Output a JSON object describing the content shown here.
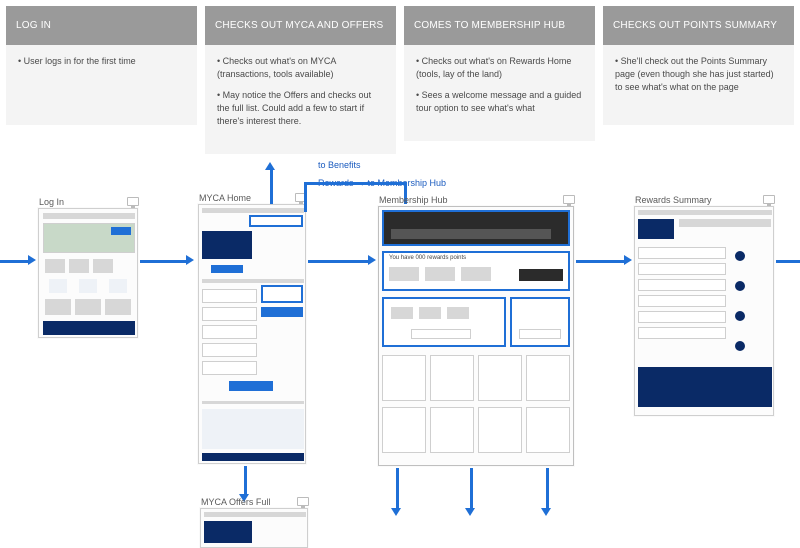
{
  "steps": [
    {
      "title": "LOG IN",
      "bullets": [
        "User logs in for the first time"
      ]
    },
    {
      "title": "CHECKS OUT MYCA AND OFFERS",
      "bullets": [
        "Checks out what's on MYCA (transactions, tools available)",
        "May notice the Offers and checks out the full list. Could add a few to start if there's interest there."
      ]
    },
    {
      "title": "COMES TO MEMBERSHIP HUB",
      "bullets": [
        "Checks out what's on Rewards Home (tools, lay of the land)",
        "Sees a welcome message and a guided tour option to see what's what"
      ]
    },
    {
      "title": "CHECKS OUT POINTS SUMMARY",
      "bullets": [
        "She'll check out the Points Summary page (even though she has just started) to see what's what on the page"
      ]
    }
  ],
  "flow_labels": {
    "to_benefits": "to Benefits",
    "rewards_to_hub": "Rewards → to Membership Hub"
  },
  "screens": {
    "login": "Log In",
    "myca_home": "MYCA Home",
    "membership_hub": "Membership Hub",
    "rewards_summary": "Rewards Summary",
    "myca_offers_full": "MYCA Offers Full"
  },
  "hub_text": {
    "points_line": "You have 000 rewards points"
  }
}
